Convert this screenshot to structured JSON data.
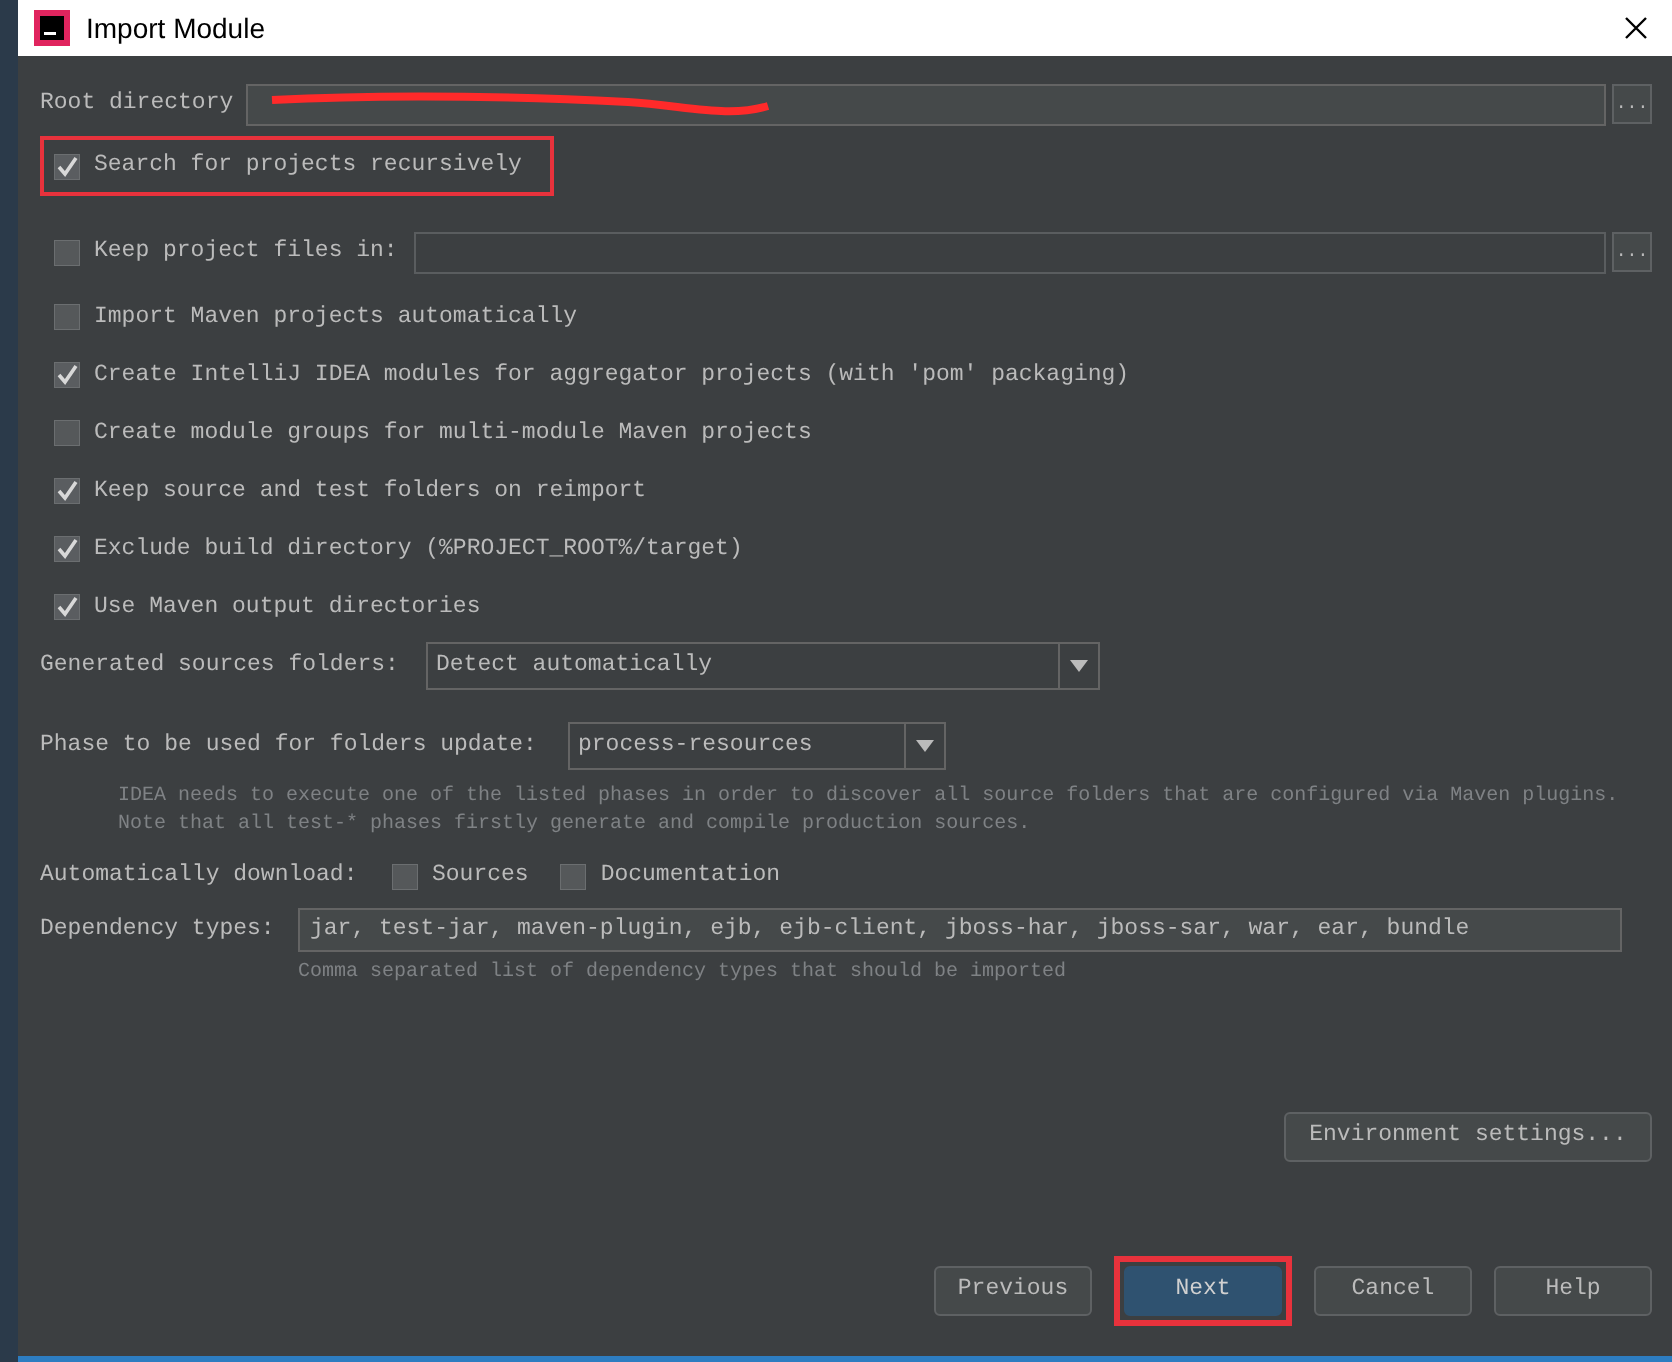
{
  "window": {
    "title": "Import Module"
  },
  "root_directory": {
    "label": "Root directory",
    "redacted": true,
    "browse_button": "..."
  },
  "search_recursively": {
    "label": "Search for projects recursively",
    "checked": true,
    "highlighted": true
  },
  "keep_project_files": {
    "label": "Keep project files in:",
    "checked": false,
    "browse_button": "..."
  },
  "options": [
    {
      "label": "Import Maven projects automatically",
      "checked": false
    },
    {
      "label": "Create IntelliJ IDEA modules for aggregator projects (with 'pom' packaging)",
      "checked": true
    },
    {
      "label": "Create module groups for multi-module Maven projects",
      "checked": false
    },
    {
      "label": "Keep source and test folders on reimport",
      "checked": true
    },
    {
      "label": "Exclude build directory (%PROJECT_ROOT%/target)",
      "checked": true
    },
    {
      "label": "Use Maven output directories",
      "checked": true
    }
  ],
  "generated_sources": {
    "label": "Generated sources folders:",
    "value": "Detect automatically"
  },
  "phase": {
    "label": "Phase to be used for folders update:",
    "value": "process-resources",
    "note": [
      "IDEA needs to execute one of the listed phases in order to discover all source folders that are configured via Maven plugins.",
      "Note that all test-* phases firstly generate and compile production sources."
    ]
  },
  "auto_download": {
    "label": "Automatically download:",
    "options": [
      {
        "label": "Sources",
        "checked": false
      },
      {
        "label": "Documentation",
        "checked": false
      }
    ]
  },
  "dependency_types": {
    "label": "Dependency types:",
    "value": "jar, test-jar, maven-plugin, ejb, ejb-client, jboss-har, jboss-sar, war, ear, bundle",
    "hint": "Comma separated list of dependency types that should be imported"
  },
  "environment_button": {
    "label": "Environment settings..."
  },
  "buttons": [
    {
      "label": "Previous",
      "default": false,
      "highlighted": false
    },
    {
      "label": "Next",
      "default": true,
      "highlighted": true
    },
    {
      "label": "Cancel",
      "default": false,
      "highlighted": false
    },
    {
      "label": "Help",
      "default": false,
      "highlighted": false
    }
  ]
}
